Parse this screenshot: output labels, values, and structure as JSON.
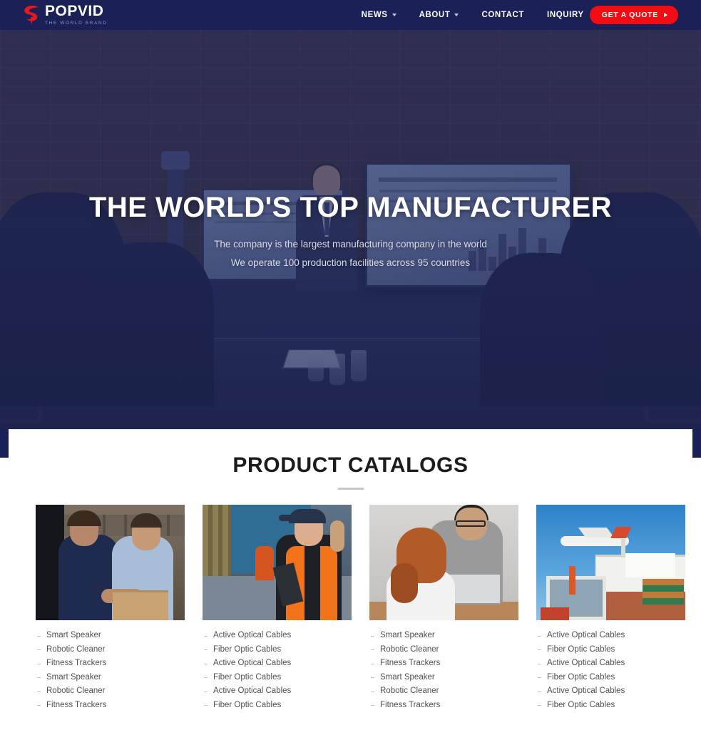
{
  "header": {
    "logo": {
      "name": "POPVID",
      "tagline": "THE WORLD BRAND",
      "icon": "swirl-logo-icon"
    },
    "nav": [
      {
        "label": "NEWS",
        "has_dropdown": true
      },
      {
        "label": "ABOUT",
        "has_dropdown": true
      },
      {
        "label": "CONTACT",
        "has_dropdown": false
      },
      {
        "label": "INQUIRY",
        "has_dropdown": false
      }
    ],
    "cta": {
      "label": "GET A QUOTE",
      "icon": "play-arrow-icon",
      "color": "#f20d14"
    },
    "background_color": "#1b2157"
  },
  "hero": {
    "title": "THE WORLD'S TOP MANUFACTURER",
    "subtitle_line1": "The company is the largest manufacturing company in the world",
    "subtitle_line2": "We operate 100 production facilities across 95 countries",
    "image_description": "boardroom presentation with businessman and screens",
    "overlay_color": "#1e265c"
  },
  "catalogs": {
    "title": "PRODUCT CATALOGS",
    "cards": [
      {
        "image_description": "two men shaking hands over cardboard box in warehouse",
        "items": [
          "Smart Speaker",
          "Robotic Cleaner",
          "Fitness Trackers",
          "Smart Speaker",
          "Robotic Cleaner",
          "Fitness Trackers"
        ]
      },
      {
        "image_description": "female worker in orange safety vest with clipboard at shipping containers",
        "items": [
          "Active Optical Cables",
          "Fiber Optic Cables",
          "Active Optical Cables",
          "Fiber Optic Cables",
          "Active Optical Cables",
          "Fiber Optic Cables"
        ]
      },
      {
        "image_description": "man with glasses and red-haired woman working at laptop",
        "items": [
          "Smart Speaker",
          "Robotic Cleaner",
          "Fitness Trackers",
          "Smart Speaker",
          "Robotic Cleaner",
          "Fitness Trackers"
        ]
      },
      {
        "image_description": "cargo airplane flying over container ship at port",
        "items": [
          "Active Optical Cables",
          "Fiber Optic Cables",
          "Active Optical Cables",
          "Fiber Optic Cables",
          "Active Optical Cables",
          "Fiber Optic Cables"
        ]
      }
    ]
  }
}
